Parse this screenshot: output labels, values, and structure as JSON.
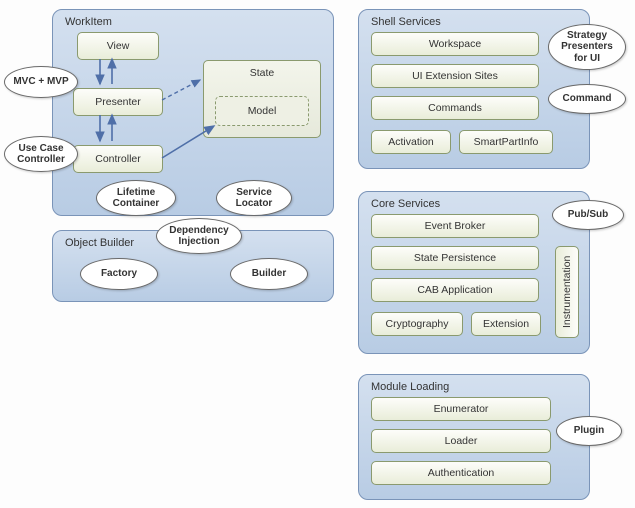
{
  "workitem": {
    "title": "WorkItem",
    "view": "View",
    "presenter": "Presenter",
    "controller": "Controller",
    "state": "State",
    "model": "Model",
    "lifetime": "Lifetime\nContainer",
    "service_locator": "Service\nLocator"
  },
  "patterns": {
    "mvc_mvp": "MVC + MVP",
    "use_case_controller": "Use Case\nController",
    "dependency_injection": "Dependency\nInjection"
  },
  "object_builder": {
    "title": "Object Builder",
    "factory": "Factory",
    "builder": "Builder"
  },
  "shell_services": {
    "title": "Shell Services",
    "workspace": "Workspace",
    "ui_ext": "UI Extension Sites",
    "commands": "Commands",
    "activation": "Activation",
    "smartpart": "SmartPartInfo",
    "strategy": "Strategy\nPresenters\nfor UI",
    "command_pattern": "Command"
  },
  "core_services": {
    "title": "Core Services",
    "event_broker": "Event Broker",
    "state_persistence": "State Persistence",
    "cab_app": "CAB Application",
    "crypto": "Cryptography",
    "extension": "Extension",
    "instrumentation": "Instrumentation",
    "pubsub": "Pub/Sub"
  },
  "module_loading": {
    "title": "Module Loading",
    "enumerator": "Enumerator",
    "loader": "Loader",
    "authentication": "Authentication",
    "plugin": "Plugin"
  }
}
